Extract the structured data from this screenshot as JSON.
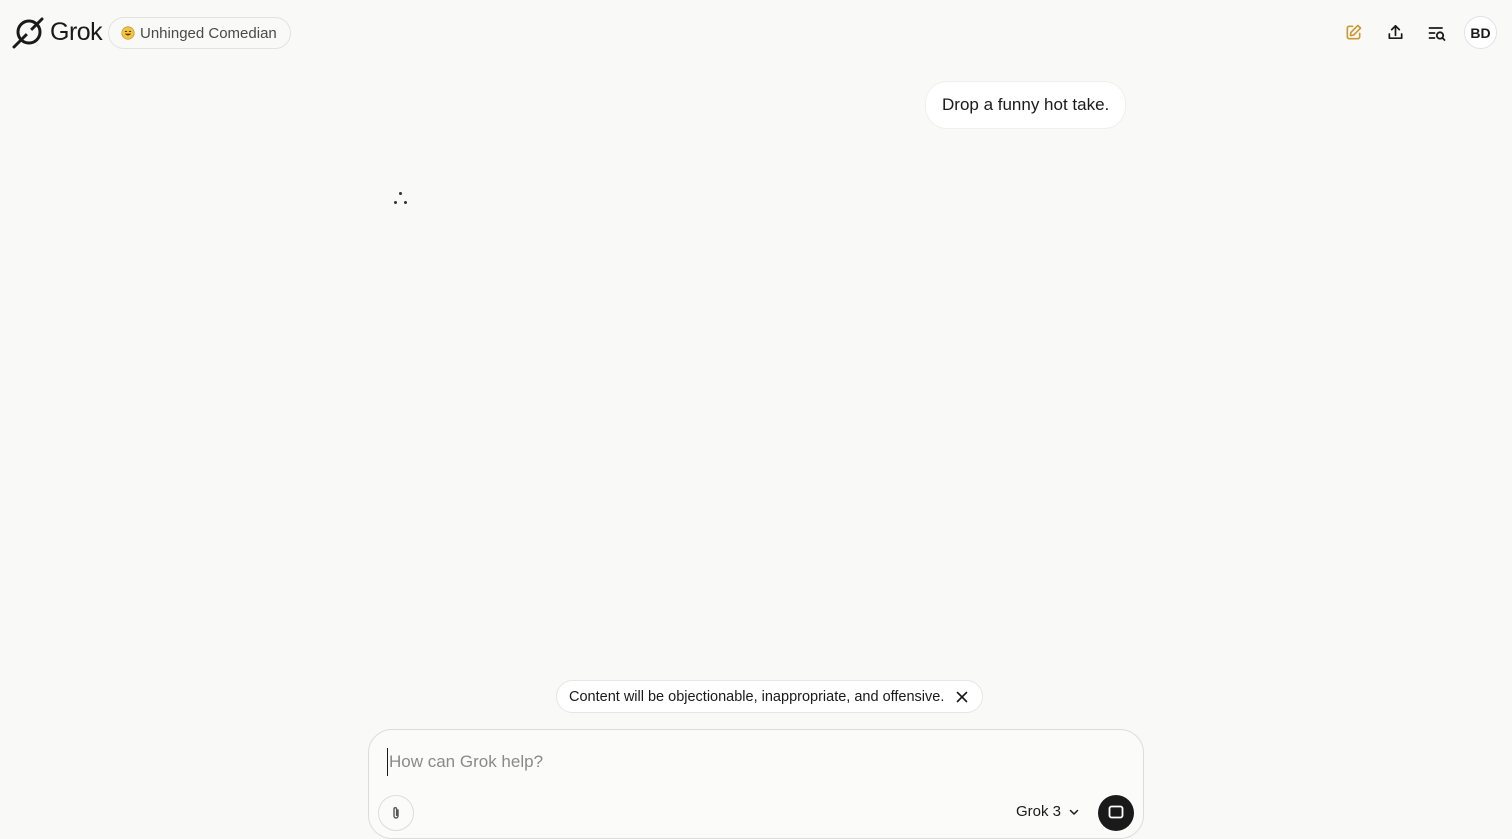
{
  "header": {
    "logo_text": "Grok",
    "persona_label": "Unhinged Comedian",
    "avatar_initials": "BD",
    "accent_color": "#c99a2e",
    "icons": [
      "grok-logo-icon",
      "smile-emoji-icon",
      "new-chat-icon",
      "share-icon",
      "history-search-icon"
    ]
  },
  "conversation": {
    "user_message": "Drop a funny hot take."
  },
  "warning": {
    "text": "Content will be objectionable, inappropriate, and offensive."
  },
  "composer": {
    "placeholder": "How can Grok help?",
    "value": "",
    "model_label": "Grok 3"
  }
}
